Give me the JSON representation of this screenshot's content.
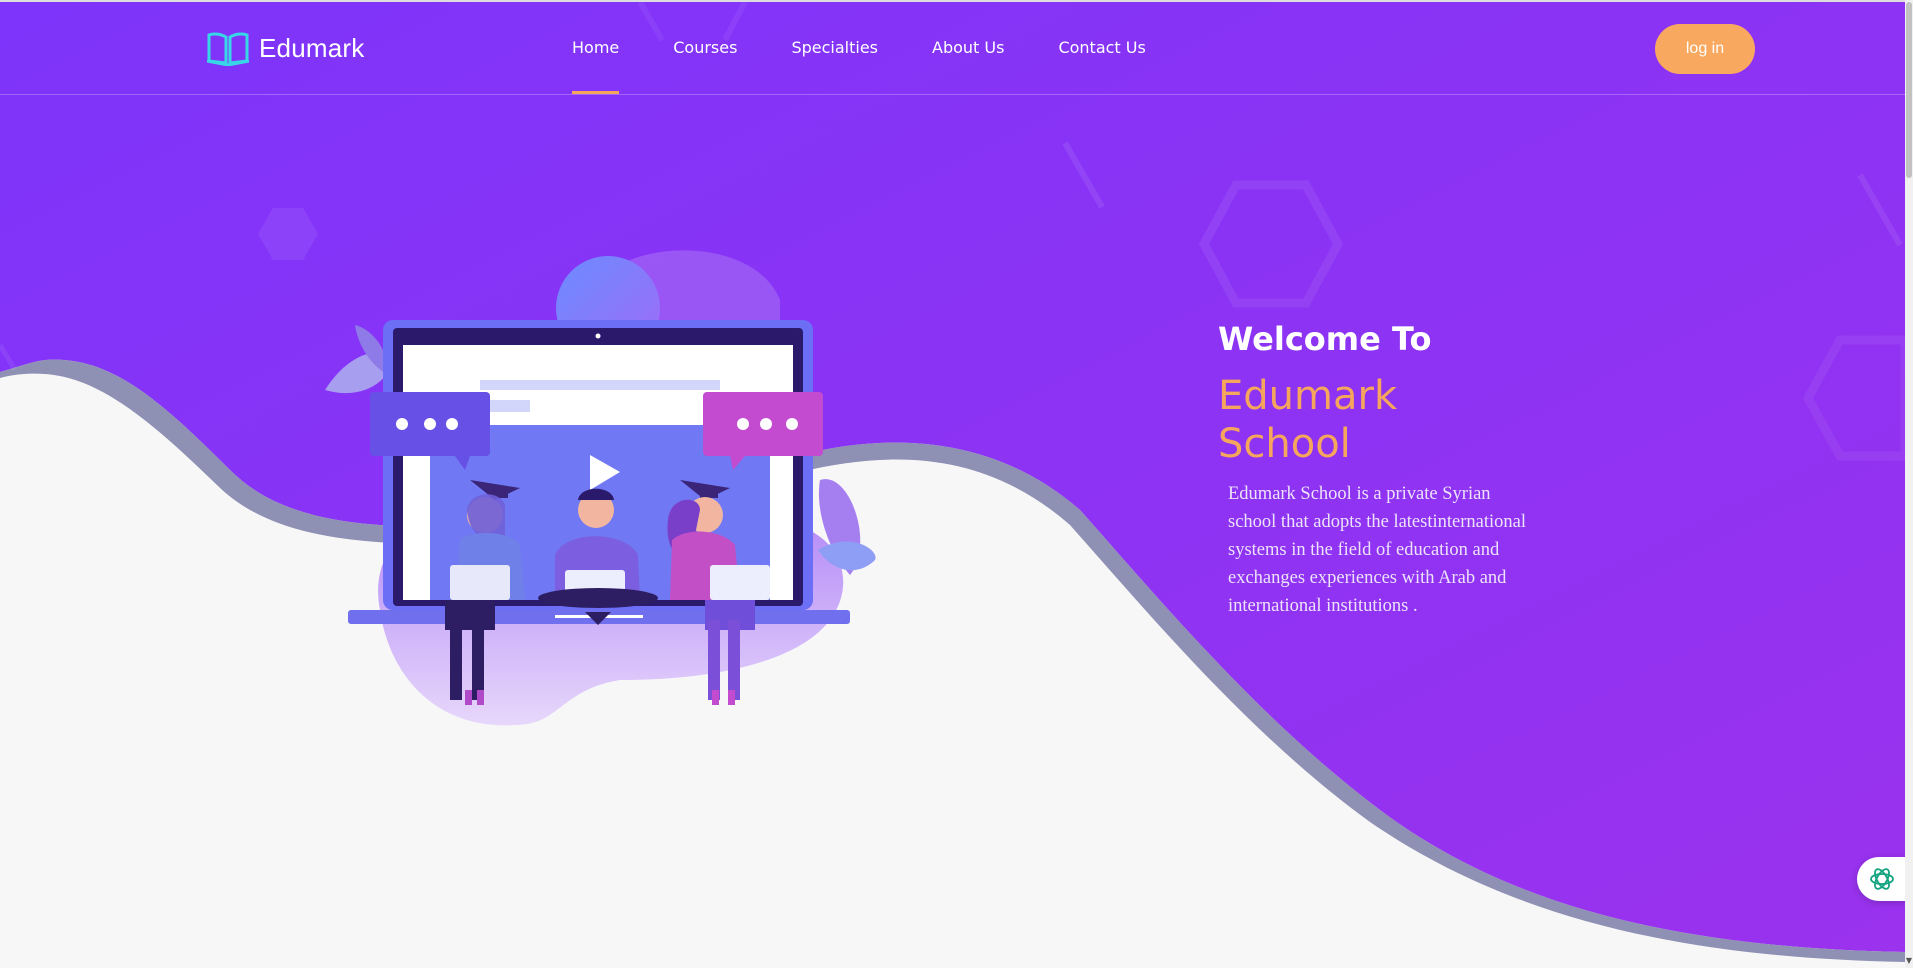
{
  "brand": {
    "name": "Edumark",
    "logo_icon": "open-book-icon"
  },
  "nav": {
    "items": [
      {
        "label": "Home",
        "active": true
      },
      {
        "label": "Courses"
      },
      {
        "label": "Specialties"
      },
      {
        "label": "About Us"
      },
      {
        "label": "Contact Us"
      }
    ],
    "login_label": "log in"
  },
  "hero": {
    "welcome": "Welcome To",
    "school_line1": "Edumark",
    "school_line2": "School",
    "description": "Edumark School is a private Syrian school that adopts the latestinternational systems in the field of education and exchanges experiences with Arab and international institutions ."
  },
  "colors": {
    "primary": "#8a33f7",
    "accent": "#f9a95f",
    "page_bg": "#f7f7f8"
  },
  "chat_widget": {
    "icon": "chat-assistant-icon"
  }
}
